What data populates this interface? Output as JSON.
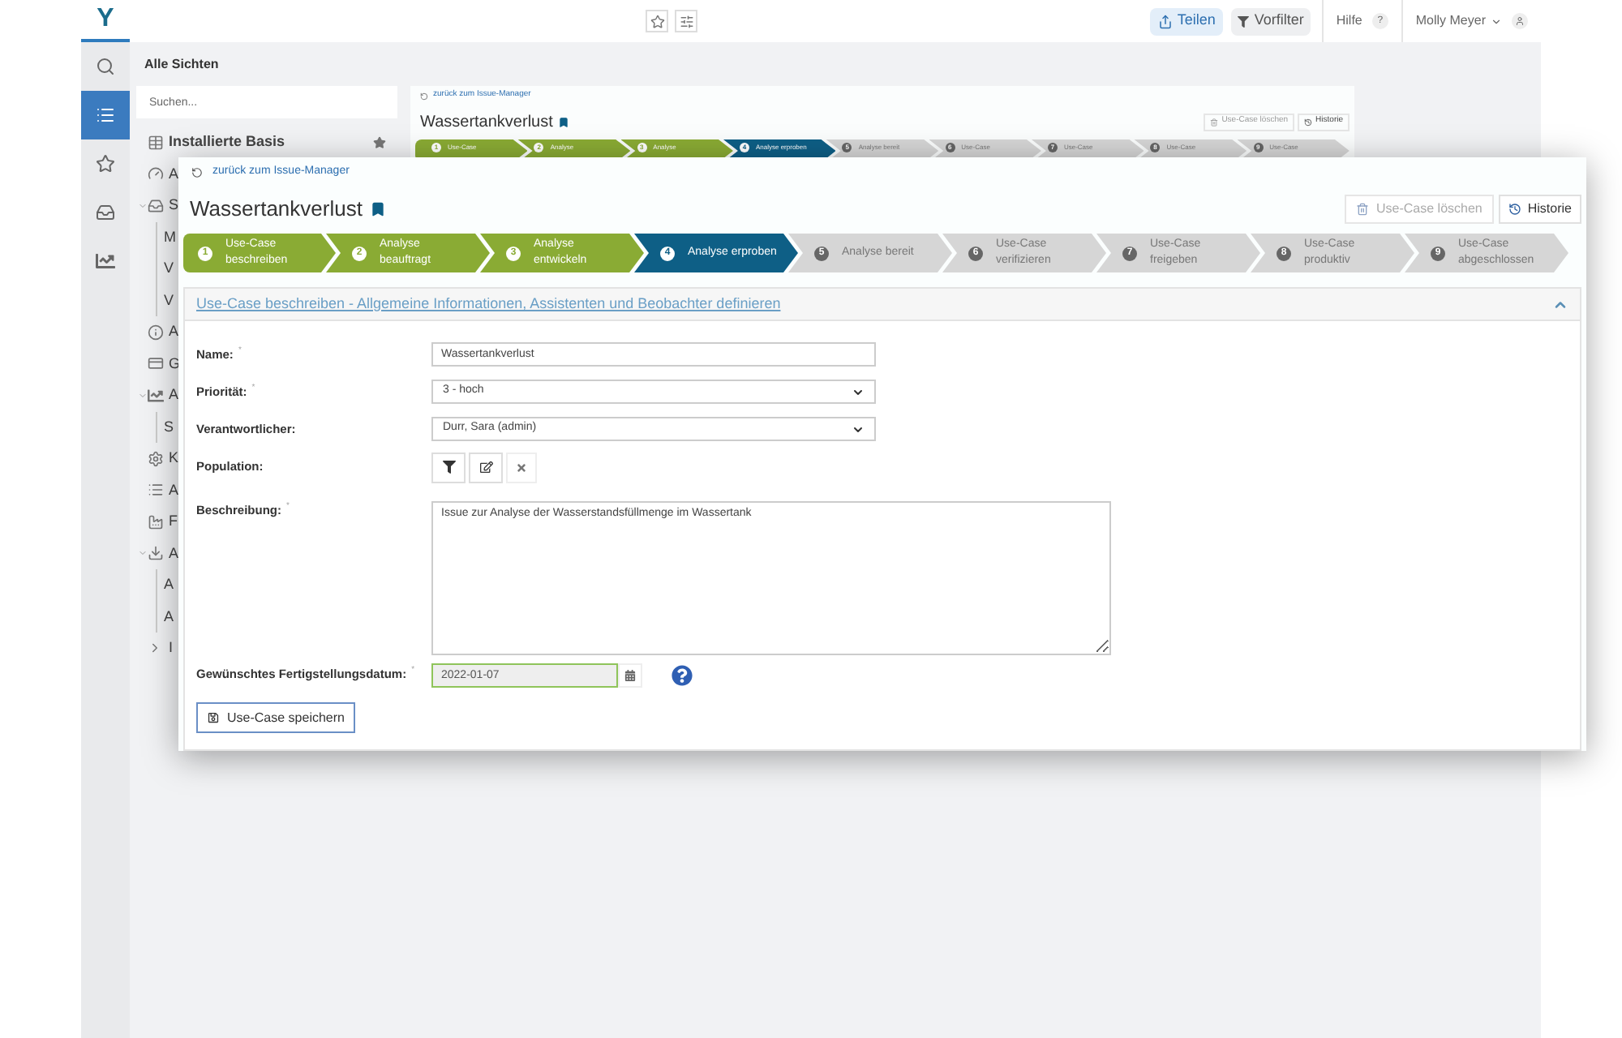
{
  "top_bar": {
    "logo": "Y",
    "share_button": "Teilen",
    "prefilter_button": "Vorfilter",
    "help_label": "Hilfe",
    "help_badge": "?",
    "user_name": "Molly Meyer"
  },
  "rail": [
    {
      "selected": false
    },
    {
      "selected": true
    },
    {
      "selected": false
    },
    {
      "selected": false
    },
    {
      "selected": false
    }
  ],
  "sidebar": {
    "title": "Alle Sichten",
    "search_placeholder": "Suchen...",
    "items": [
      {
        "label": "Installierte Basis",
        "favorite": true
      },
      {
        "label": "A"
      },
      {
        "label": "S",
        "expanded": true,
        "children": [
          {
            "label": "M"
          },
          {
            "label": "V"
          },
          {
            "label": "V"
          }
        ]
      },
      {
        "label": "A"
      },
      {
        "label": "G"
      },
      {
        "label": "A",
        "expanded": true,
        "children": [
          {
            "label": "S"
          }
        ]
      },
      {
        "label": "K"
      },
      {
        "label": "A"
      },
      {
        "label": "F"
      },
      {
        "label": "A",
        "expanded": true,
        "children": [
          {
            "label": "A"
          },
          {
            "label": "A"
          }
        ]
      },
      {
        "label": "I",
        "expanded": false
      }
    ]
  },
  "background_view": {
    "back_link": "zurück zum Issue-Manager",
    "title": "Wassertankverlust",
    "delete_button": "Use-Case löschen",
    "history_button": "Historie",
    "steps": [
      {
        "number": "1",
        "label": "Use-Case",
        "completed": true,
        "selected": false
      },
      {
        "number": "2",
        "label": "Analyse",
        "completed": true,
        "selected": false
      },
      {
        "number": "3",
        "label": "Analyse",
        "completed": true,
        "selected": false
      },
      {
        "number": "4",
        "label": "Analyse erproben",
        "completed": false,
        "selected": true
      },
      {
        "number": "5",
        "label": "Analyse bereit",
        "completed": false,
        "selected": false
      },
      {
        "number": "6",
        "label": "Use-Case",
        "completed": false,
        "selected": false
      },
      {
        "number": "7",
        "label": "Use-Case",
        "completed": false,
        "selected": false
      },
      {
        "number": "8",
        "label": "Use-Case",
        "completed": false,
        "selected": false
      },
      {
        "number": "9",
        "label": "Use-Case",
        "completed": false,
        "selected": false
      }
    ]
  },
  "issue_view": {
    "back_link": "zurück zum Issue-Manager",
    "title": "Wassertankverlust",
    "delete_button": {
      "label": "Use-Case löschen",
      "disabled": true
    },
    "history_button": "Historie",
    "steps": [
      {
        "number": "1",
        "lines": [
          "Use-Case",
          "beschreiben"
        ],
        "completed": true,
        "selected": false
      },
      {
        "number": "2",
        "lines": [
          "Analyse",
          "beauftragt"
        ],
        "completed": true,
        "selected": false
      },
      {
        "number": "3",
        "lines": [
          "Analyse",
          "entwickeln"
        ],
        "completed": true,
        "selected": false
      },
      {
        "number": "4",
        "lines": [
          "Analyse erproben"
        ],
        "completed": false,
        "selected": true
      },
      {
        "number": "5",
        "lines": [
          "Analyse bereit"
        ],
        "completed": false,
        "selected": false
      },
      {
        "number": "6",
        "lines": [
          "Use-Case",
          "verifizieren"
        ],
        "completed": false,
        "selected": false
      },
      {
        "number": "7",
        "lines": [
          "Use-Case",
          "freigeben"
        ],
        "completed": false,
        "selected": false
      },
      {
        "number": "8",
        "lines": [
          "Use-Case",
          "produktiv"
        ],
        "completed": false,
        "selected": false
      },
      {
        "number": "9",
        "lines": [
          "Use-Case",
          "abgeschlossen"
        ],
        "completed": false,
        "selected": false
      }
    ],
    "section": {
      "title": "Use-Case beschreiben - Allgemeine Informationen, Assistenten und Beobachter definieren",
      "expanded": true
    },
    "required_mark": "*",
    "fields": [
      {
        "kind": "text",
        "label": "Name:",
        "required": true,
        "value": "Wassertankverlust"
      },
      {
        "kind": "select",
        "label": "Priorität:",
        "required": true,
        "value": "3 - hoch"
      },
      {
        "kind": "select",
        "label": "Verantwortlicher:",
        "required": false,
        "value": "Durr, Sara (admin)"
      },
      {
        "kind": "population",
        "label": "Population:",
        "required": false
      },
      {
        "kind": "textarea",
        "label": "Beschreibung:",
        "required": true,
        "value": "Issue zur Analyse der Wasserstandsfüllmenge im Wassertank"
      },
      {
        "kind": "date",
        "label": "Gewünschtes Fertigstellungsdatum:",
        "required": true,
        "value": "2022-01-07"
      }
    ],
    "save_button": "Use-Case speichern"
  }
}
